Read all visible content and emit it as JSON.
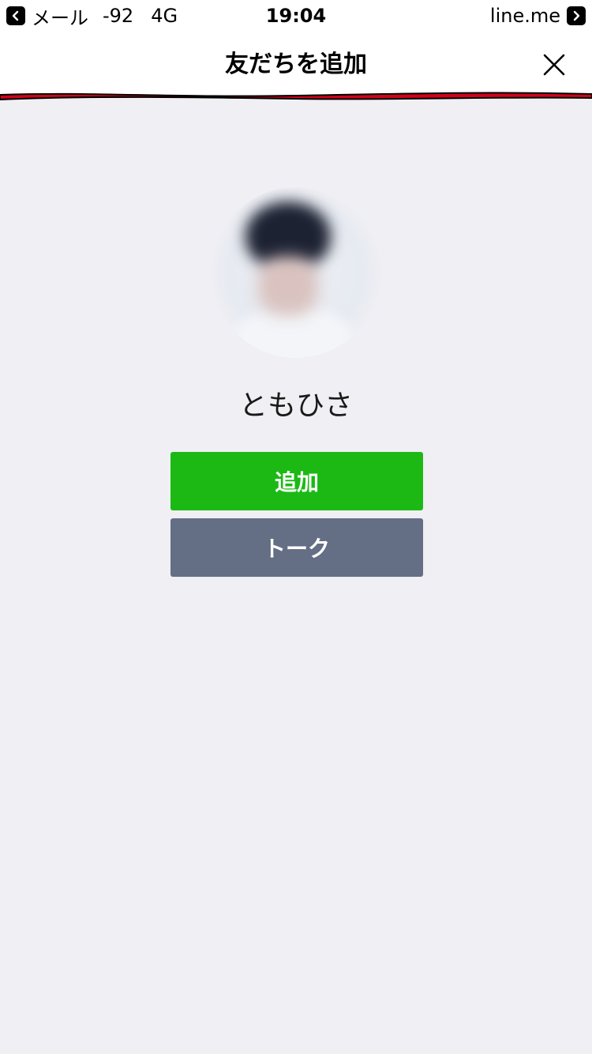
{
  "status_bar": {
    "back_app": "メール",
    "signal": "-92",
    "network": "4G",
    "time": "19:04",
    "domain": "line.me"
  },
  "header": {
    "title": "友だちを追加",
    "divider_color": "#d0021b"
  },
  "profile": {
    "name": "ともひさ"
  },
  "actions": {
    "add_label": "追加",
    "talk_label": "トーク",
    "add_color": "#1cb915",
    "talk_color": "#646f86"
  },
  "icons": {
    "back": "chevron-left-icon",
    "forward": "chevron-right-icon",
    "close": "close-icon"
  }
}
